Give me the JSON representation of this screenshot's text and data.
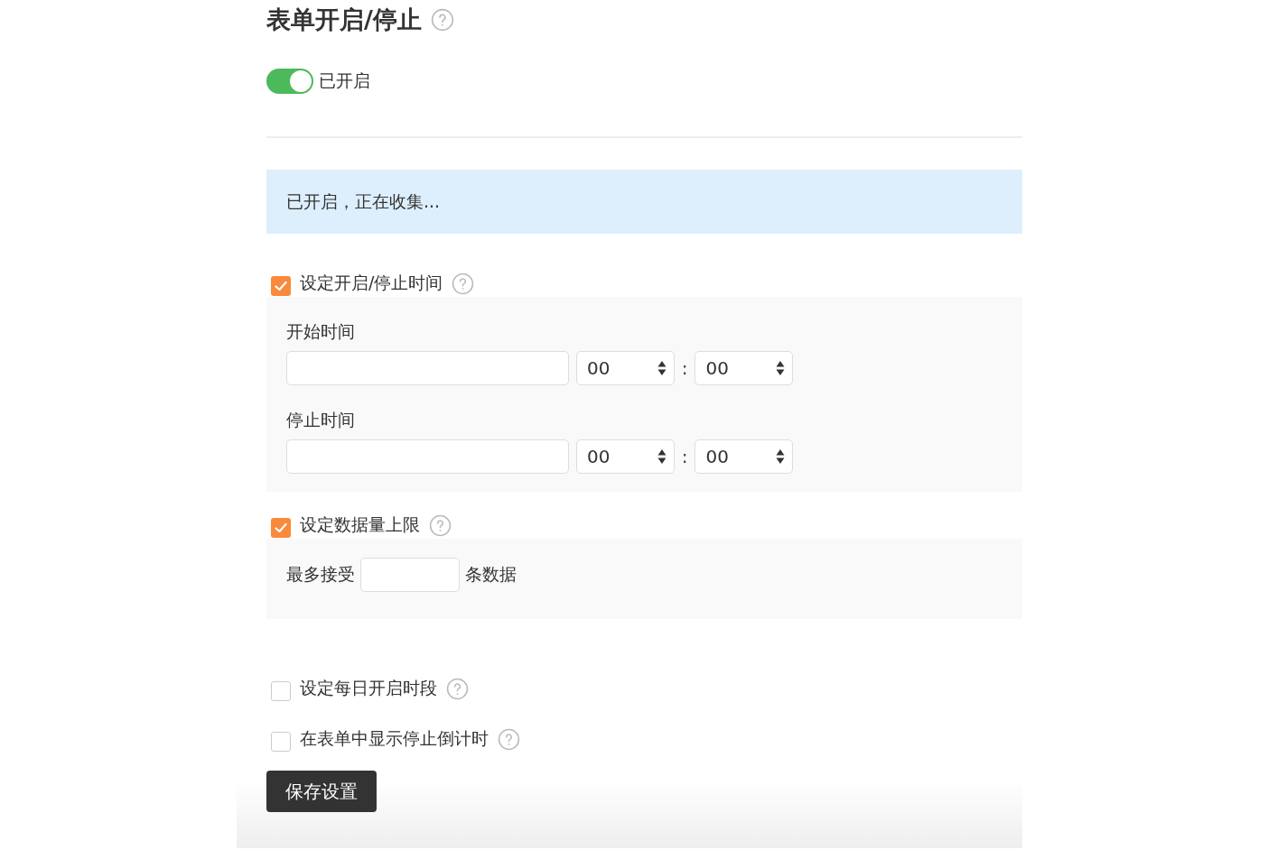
{
  "title": "表单开启/停止",
  "toggle": {
    "on": true,
    "label": "已开启"
  },
  "notice": "已开启，正在收集...",
  "options": [
    {
      "label": "设定开启/停止时间",
      "checked": true,
      "panel": {
        "kind": "time_range",
        "rows": [
          {
            "label": "开始时间",
            "hour": "00",
            "separator": ":",
            "minute": "00"
          },
          {
            "label": "停止时间",
            "hour": "00",
            "separator": ":",
            "minute": "00"
          }
        ]
      }
    },
    {
      "label": "设定数据量上限",
      "checked": true,
      "panel": {
        "kind": "limit",
        "prefix": "最多接受",
        "suffix": "条数据"
      }
    },
    {
      "label": "设定每日开启时段",
      "checked": false
    },
    {
      "label": "在表单中显示停止倒计时",
      "checked": false
    }
  ],
  "save_button": "保存设置"
}
